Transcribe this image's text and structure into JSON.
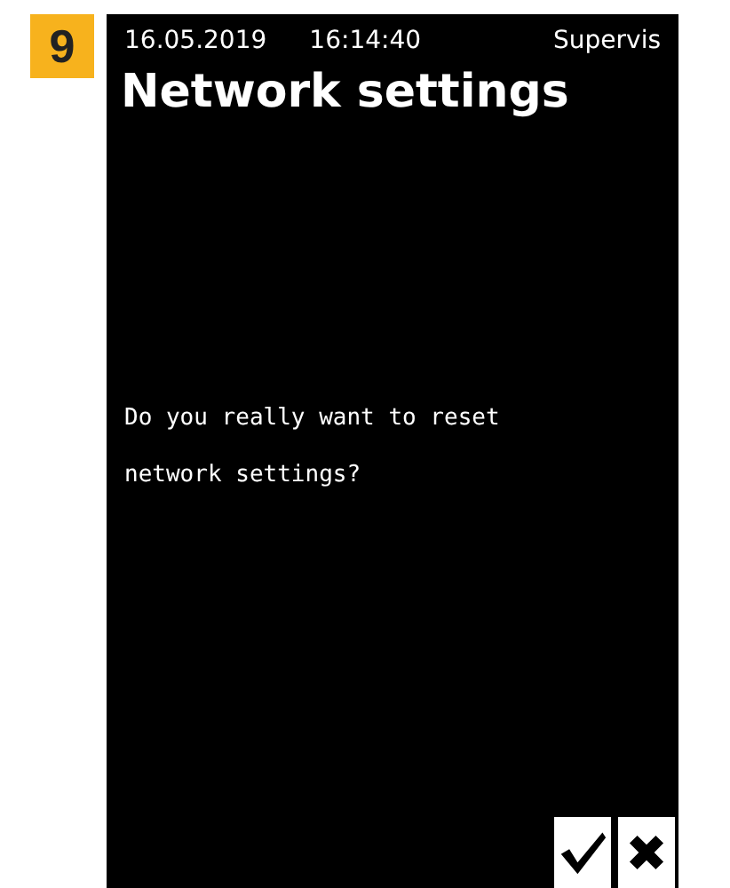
{
  "step_badge": "9",
  "status_bar": {
    "date": "16.05.2019",
    "time": "16:14:40",
    "user": "Supervis"
  },
  "title": "Network settings",
  "message": "Do you really want to reset network settings?",
  "buttons": [
    {
      "kind": "confirm"
    },
    {
      "kind": "cancel"
    }
  ]
}
